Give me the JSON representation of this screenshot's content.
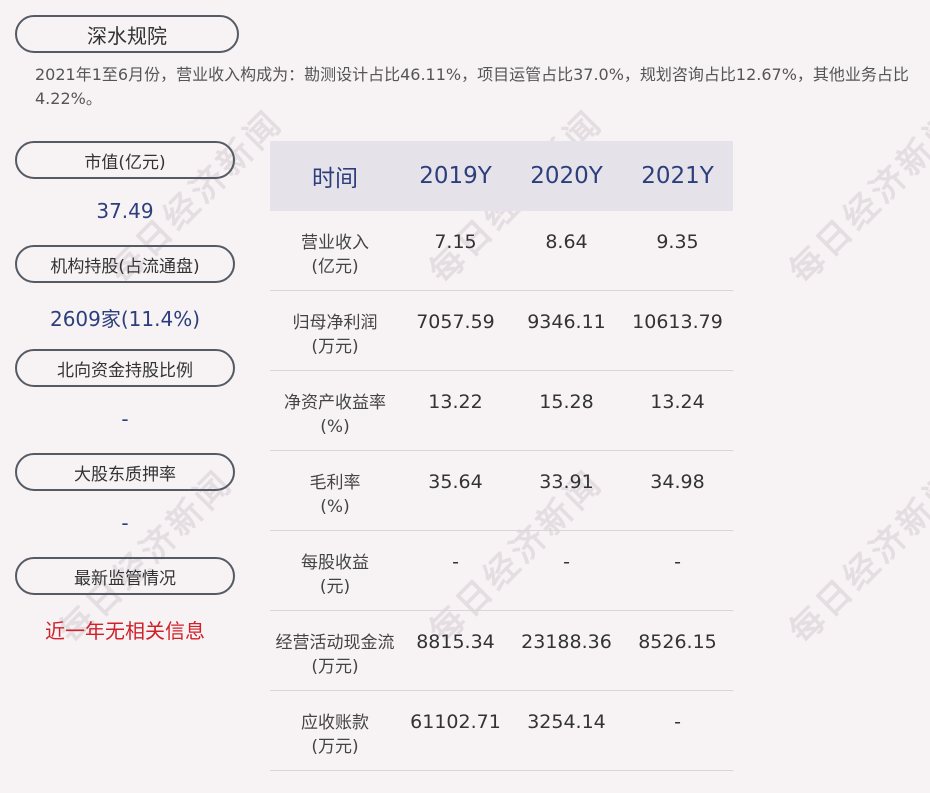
{
  "company": "深水规院",
  "description": "2021年1至6月份，营业收入构成为：勘测设计占比46.11%，项目运管占比37.0%，规划咨询占比12.67%，其他业务占比4.22%。",
  "metrics": [
    {
      "label": "市值(亿元)",
      "value": "37.49"
    },
    {
      "label": "机构持股(占流通盘)",
      "value": "2609家(11.4%)"
    },
    {
      "label": "北向资金持股比例",
      "value": "-"
    },
    {
      "label": "大股东质押率",
      "value": "-"
    },
    {
      "label": "最新监管情况",
      "value": "近一年无相关信息"
    }
  ],
  "table": {
    "headers": [
      "时间",
      "2019Y",
      "2020Y",
      "2021Y"
    ],
    "rows": [
      {
        "label1": "营业收入",
        "label2": "(亿元)",
        "values": [
          "7.15",
          "8.64",
          "9.35"
        ]
      },
      {
        "label1": "归母净利润",
        "label2": "(万元)",
        "values": [
          "7057.59",
          "9346.11",
          "10613.79"
        ]
      },
      {
        "label1": "净资产收益率",
        "label2": "(%)",
        "values": [
          "13.22",
          "15.28",
          "13.24"
        ]
      },
      {
        "label1": "毛利率",
        "label2": "(%)",
        "values": [
          "35.64",
          "33.91",
          "34.98"
        ]
      },
      {
        "label1": "每股收益",
        "label2": "(元)",
        "values": [
          "-",
          "-",
          "-"
        ]
      },
      {
        "label1": "经营活动现金流",
        "label2": "(万元)",
        "values": [
          "8815.34",
          "23188.36",
          "8526.15"
        ]
      },
      {
        "label1": "应收账款",
        "label2": "(万元)",
        "values": [
          "61102.71",
          "3254.14",
          "-"
        ]
      }
    ]
  },
  "watermark": "每日经济新闻",
  "colors": {
    "accent": "#2c3f7c",
    "alert": "#d0212a",
    "background": "#f7f3f5",
    "header_bg": "#e6e2e9"
  }
}
